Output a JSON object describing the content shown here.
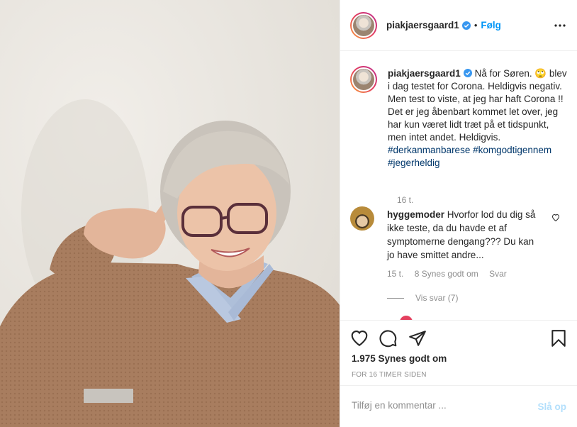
{
  "post": {
    "username": "piakjaersgaard1",
    "follow_label": "Følg",
    "separator": "•",
    "icons": {
      "verified": "verified-badge-icon",
      "more": "more-options-icon",
      "like": "heart-icon",
      "comment": "comment-bubble-icon",
      "share": "paper-plane-icon",
      "save": "bookmark-icon"
    },
    "caption": {
      "username": "piakjaersgaard1",
      "text": "Nå for Søren. 🙄 blev i dag testet for Corona. Heldigvis negativ. Men test to viste, at jeg har haft Corona !! Det er jeg åbenbart kommet let over, jeg har kun været lidt træt på et tidspunkt, men intet andet. Heldigvis.",
      "hashtags": [
        "#derkanmanbarese",
        "#komgodtigennem",
        "#jegerheldig"
      ],
      "time": "16 t."
    },
    "comments": [
      {
        "username": "hyggemoder",
        "text": "Hvorfor lod du dig så ikke teste, da du havde et af symptomerne dengang??? Du kan jo have smittet andre...",
        "time": "15 t.",
        "likes": "8 Synes godt om",
        "reply_label": "Svar",
        "view_replies": "Vis svar (7)"
      }
    ],
    "likes": "1.975 Synes godt om",
    "timestamp": "FOR 16 TIMER SIDEN",
    "add_comment_placeholder": "Tilføj en kommentar ...",
    "post_button": "Slå op"
  },
  "colors": {
    "accent": "#0095f6",
    "hashtag": "#00376b",
    "muted": "#8e8e8e",
    "post_disabled": "#b2dffc",
    "sweater": "#a87d5f"
  }
}
